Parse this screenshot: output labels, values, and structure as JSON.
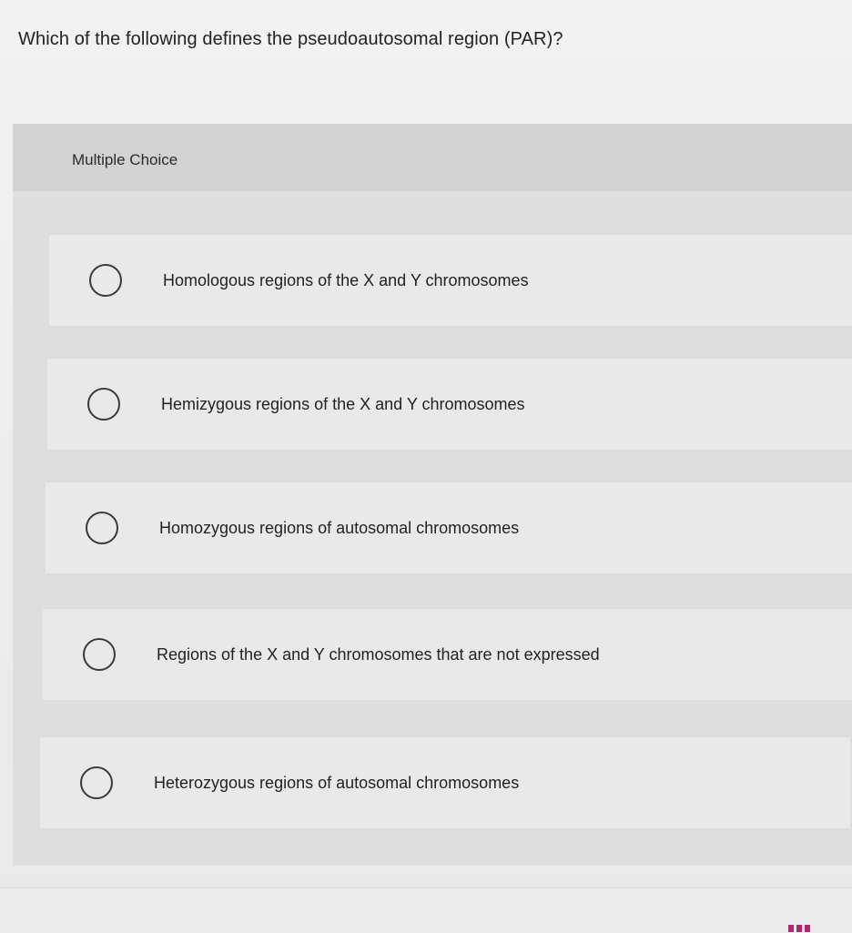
{
  "question": {
    "text": "Which of the following defines the pseudoautosomal region (PAR)?"
  },
  "panel": {
    "label": "Multiple Choice"
  },
  "options": [
    {
      "label": "Homologous regions of the X and Y chromosomes",
      "selected": false
    },
    {
      "label": "Hemizygous regions of the X and Y chromosomes",
      "selected": false
    },
    {
      "label": "Homozygous regions of autosomal chromosomes",
      "selected": false
    },
    {
      "label": "Regions of the X and Y chromosomes that are not expressed",
      "selected": false
    },
    {
      "label": "Heterozygous regions of autosomal chromosomes",
      "selected": false
    }
  ],
  "colors": {
    "panel_background": "#dedede",
    "option_background": "#e9e9e9",
    "radio_border": "#3a3a3a",
    "footer_accent": "#b0286e"
  },
  "icons": {
    "radio": "radio-button-icon"
  }
}
